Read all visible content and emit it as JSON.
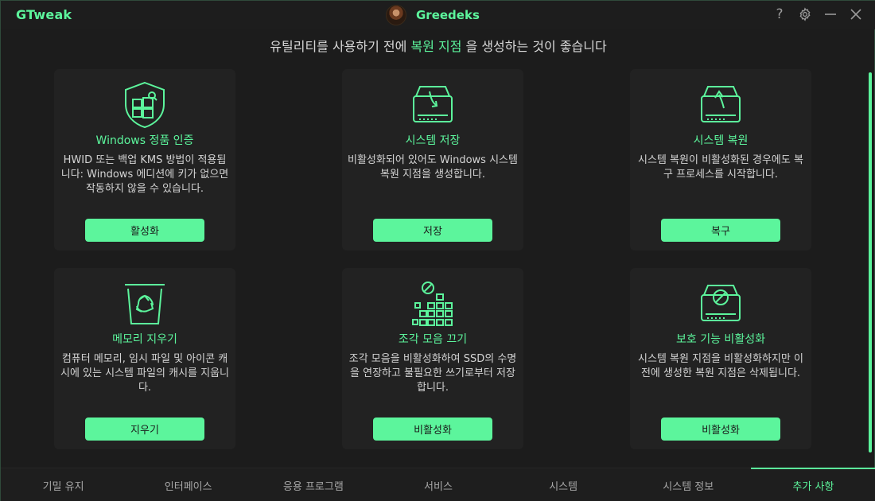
{
  "app": {
    "title": "GTweak",
    "author": "Greedeks"
  },
  "window_controls": {
    "help": "?",
    "settings": "gear-icon",
    "minimize": "minimize-icon",
    "close": "close-icon"
  },
  "banner": {
    "before": "유틸리티를 사용하기 전에 ",
    "accent": "복원 지점",
    "after": " 을 생성하는 것이 좋습니다"
  },
  "cards": [
    {
      "icon": "shield-windows-icon",
      "title": "Windows 정품 인증",
      "desc": "HWID 또는 백업 KMS 방법이 적용됩니다: Windows 에디션에 키가 없으면 작동하지 않을 수 있습니다.",
      "button": "활성화"
    },
    {
      "icon": "drive-save-icon",
      "title": "시스템 저장",
      "desc": "비활성화되어 있어도 Windows 시스템 복원 지점을 생성합니다.",
      "button": "저장"
    },
    {
      "icon": "drive-restore-icon",
      "title": "시스템 복원",
      "desc": "시스템 복원이 비활성화된 경우에도 복구 프로세스를 시작합니다.",
      "button": "복구"
    },
    {
      "icon": "recycle-bin-icon",
      "title": "메모리 지우기",
      "desc": "컴퓨터 메모리, 임시 파일 및 아이콘 캐시에 있는 시스템 파일의 캐시를 지웁니다.",
      "button": "지우기"
    },
    {
      "icon": "defrag-blocks-icon",
      "title": "조각 모음 끄기",
      "desc": "조각 모음을 비활성화하여 SSD의 수명을 연장하고 불필요한 쓰기로부터 저장합니다.",
      "button": "비활성화"
    },
    {
      "icon": "drive-protect-off-icon",
      "title": "보호 기능 비활성화",
      "desc": "시스템 복원 지점을 비활성화하지만 이전에 생성한 복원 지점은 삭제됩니다.",
      "button": "비활성화"
    }
  ],
  "nav": {
    "tabs": [
      "기밀 유지",
      "인터페이스",
      "응용 프로그램",
      "서비스",
      "시스템",
      "시스템 정보",
      "추가 사항"
    ],
    "active": "추가 사항"
  },
  "colors": {
    "accent": "#5cf59c",
    "background": "#1c1c1c",
    "card": "#222222"
  }
}
